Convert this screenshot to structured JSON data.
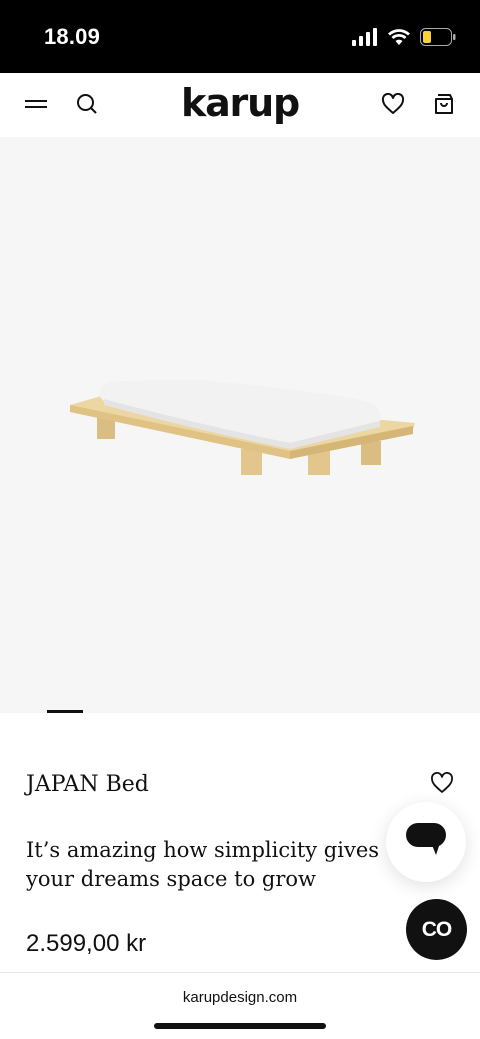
{
  "status_bar": {
    "time": "18.09",
    "icons": [
      "cellular-signal-icon",
      "wifi-icon",
      "battery-low-icon"
    ]
  },
  "header": {
    "brand": "karup",
    "icons": [
      "menu-icon",
      "search-icon",
      "heart-icon",
      "bag-icon"
    ]
  },
  "product": {
    "title": "JAPAN Bed",
    "tagline": "It’s amazing how simplicity gives your dreams space to grow",
    "price": "2.599,00 kr",
    "image_icon": "bed-product-image",
    "carousel": {
      "current": 1
    }
  },
  "floating": {
    "chat_icon": "chat-bubble-icon",
    "co_label": "CO"
  },
  "browser": {
    "url": "karupdesign.com"
  },
  "colors": {
    "status_bg": "#000000",
    "image_bg": "#f6f6f6",
    "wood": "#e8cf96",
    "mattress": "#f2f2f2",
    "battery_yellow": "#f7d23a"
  }
}
